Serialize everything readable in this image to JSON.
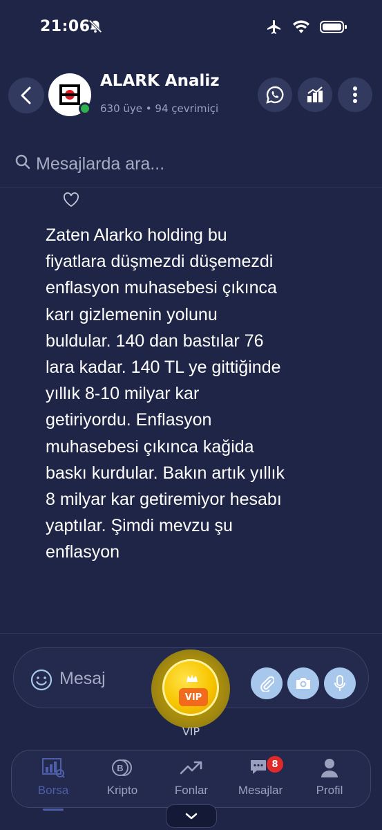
{
  "status_bar": {
    "time": "21:06",
    "icons": [
      "bell-off-icon",
      "airplane-icon",
      "wifi-icon",
      "battery-icon"
    ]
  },
  "header": {
    "group_name": "ALARK Analiz",
    "group_meta": "630 üye • 94 çevrimiçi",
    "online": true,
    "actions": [
      "whatsapp-icon",
      "chart-icon",
      "more-icon"
    ]
  },
  "search": {
    "placeholder": "Mesajlarda ara..."
  },
  "message": {
    "text": "Zaten Alarko holding bu fiyatlara düşmezdi düşemezdi enflasyon muhasebesi çıkınca karı gizlemenin yolunu buldular. 140 dan bastılar 76 lara kadar. 140 TL ye gittiğinde yıllık 8-10 milyar kar getiriyordu. Enflasyon muhasebesi çıkınca kağida baskı kurdular. Bakın artık yıllık 8 milyar kar getiremiyor hesabı yaptılar. Şimdi mevzu şu enflasyon"
  },
  "composer": {
    "placeholder": "Mesaj"
  },
  "vip": {
    "badge": "VIP",
    "label": "VIP"
  },
  "nav": {
    "items": [
      {
        "label": "Borsa",
        "active": true
      },
      {
        "label": "Kripto",
        "active": false
      },
      {
        "label": "Fonlar",
        "active": false
      },
      {
        "label": "Mesajlar",
        "active": false,
        "badge": "8"
      },
      {
        "label": "Profil",
        "active": false
      }
    ]
  },
  "colors": {
    "background": "#1f2547",
    "surface": "#323a5f",
    "accent_active": "#4e5ea8",
    "online": "#2fb14b",
    "vip_gold": "#f7c600",
    "vip_orange": "#f26a1b",
    "action_blue": "#a8c7ec",
    "badge_red": "#e02a2a"
  }
}
